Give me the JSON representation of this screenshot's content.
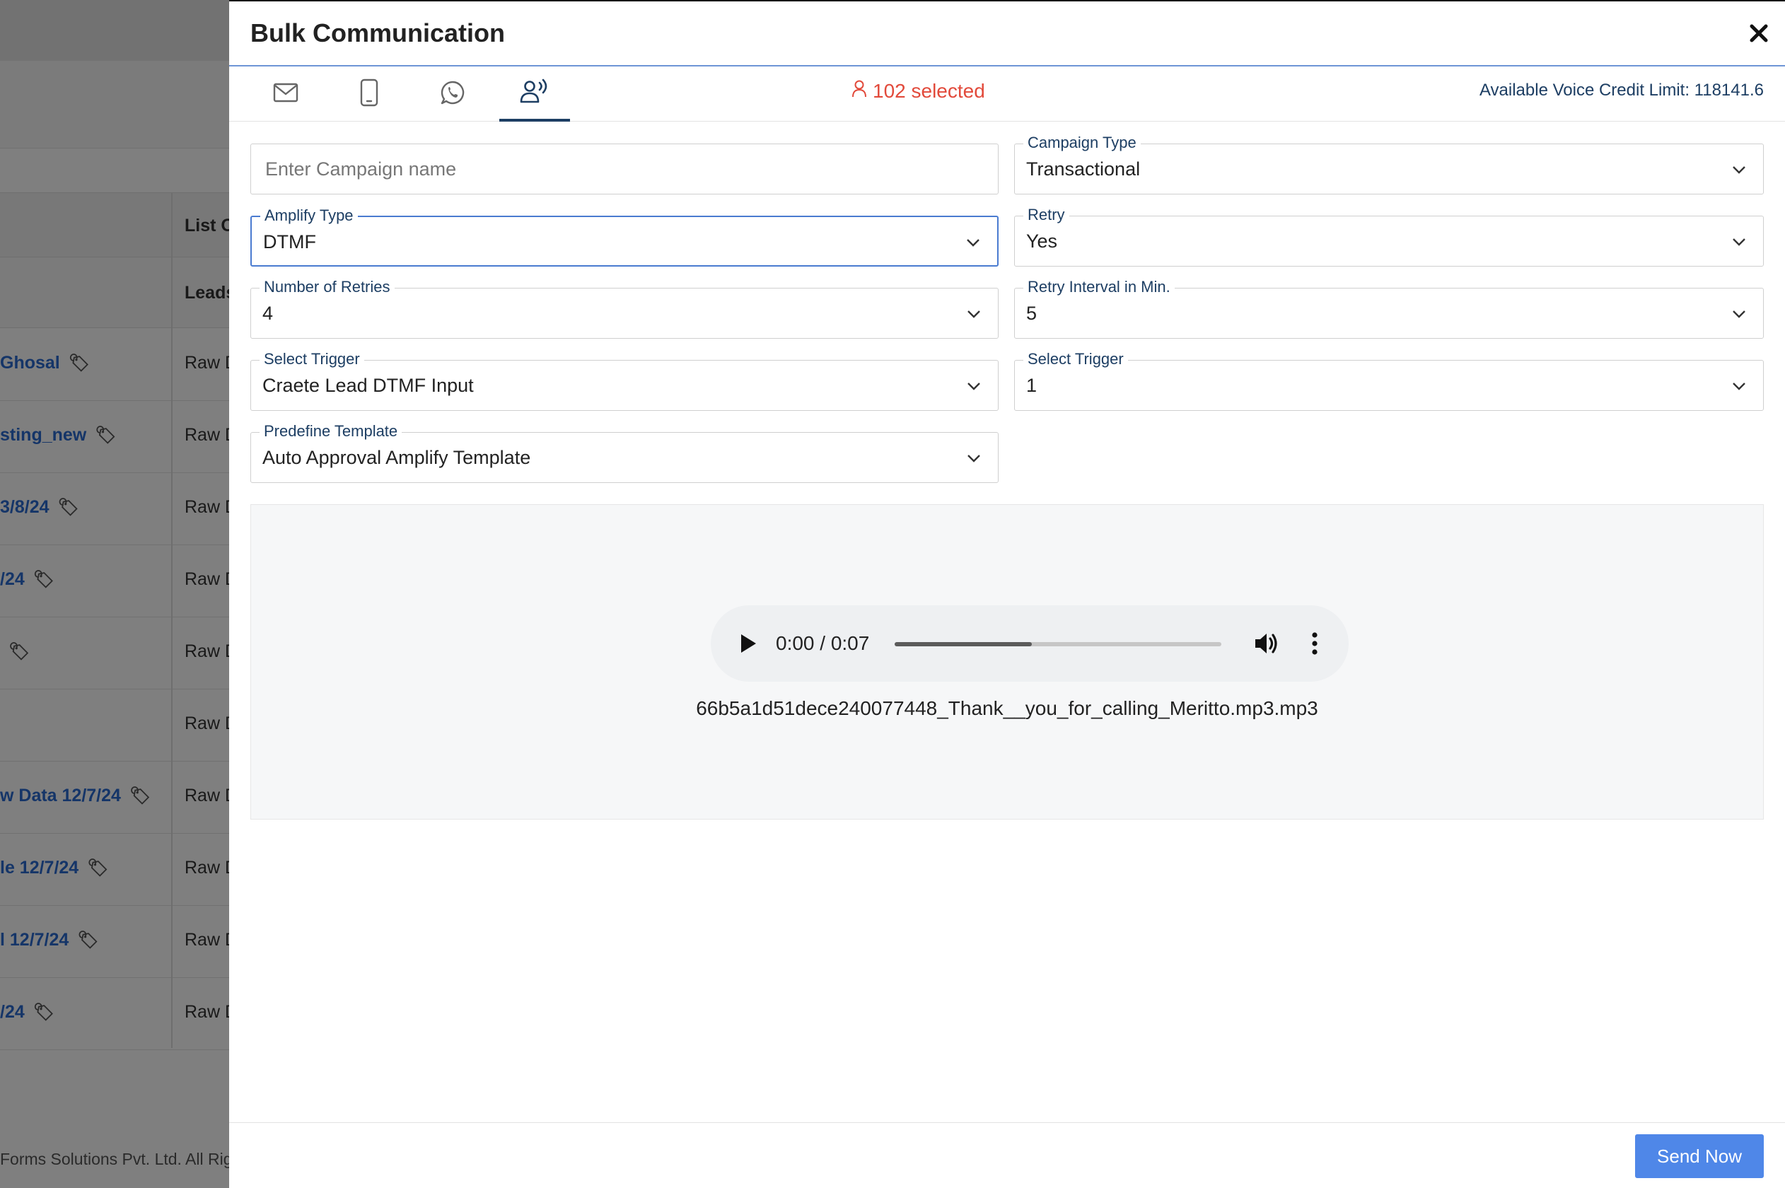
{
  "background": {
    "table_header_col2": "List O",
    "table_subheader_col2": "Leads",
    "rows": [
      {
        "name": "Ghosal",
        "col2": "Raw D"
      },
      {
        "name": "sting_new",
        "col2": "Raw D"
      },
      {
        "name": "3/8/24",
        "col2": "Raw D"
      },
      {
        "name": "/24",
        "col2": "Raw D"
      },
      {
        "name": "",
        "col2": "Raw D"
      },
      {
        "name": "",
        "col2": "Raw D"
      },
      {
        "name": "w Data 12/7/24",
        "col2": "Raw D"
      },
      {
        "name": "le 12/7/24",
        "col2": "Raw D"
      },
      {
        "name": "l 12/7/24",
        "col2": "Raw D"
      },
      {
        "name": "/24",
        "col2": "Raw D"
      }
    ],
    "footer_text": "Forms Solutions Pvt. Ltd. All Rig"
  },
  "modal": {
    "title": "Bulk Communication",
    "tabs": [
      {
        "icon": "mail-icon"
      },
      {
        "icon": "mobile-icon"
      },
      {
        "icon": "whatsapp-icon"
      },
      {
        "icon": "voice-icon",
        "active": true
      }
    ],
    "selected_count": "102 selected",
    "credit_limit": "Available Voice Credit Limit: 118141.6",
    "form": {
      "campaign_name": {
        "placeholder": "Enter Campaign name",
        "value": ""
      },
      "campaign_type": {
        "label": "Campaign Type",
        "value": "Transactional"
      },
      "amplify_type": {
        "label": "Amplify Type",
        "value": "DTMF"
      },
      "retry": {
        "label": "Retry",
        "value": "Yes"
      },
      "num_retries": {
        "label": "Number of Retries",
        "value": "4"
      },
      "retry_interval": {
        "label": "Retry Interval in Min.",
        "value": "5"
      },
      "trigger_1": {
        "label": "Select Trigger",
        "value": "Craete Lead DTMF Input"
      },
      "trigger_2": {
        "label": "Select Trigger",
        "value": "1"
      },
      "template": {
        "label": "Predefine Template",
        "value": "Auto Approval Amplify Template"
      }
    },
    "audio": {
      "time": "0:00 / 0:07",
      "progress": 0.42,
      "filename": "66b5a1d51dece240077448_Thank__you_for_calling_Meritto.mp3.mp3"
    },
    "send_button": "Send Now"
  },
  "colors": {
    "accent": "#1d3e63",
    "selected": "#e24a3b",
    "primary_button": "#4f87e8",
    "link": "#2a6bd1"
  }
}
